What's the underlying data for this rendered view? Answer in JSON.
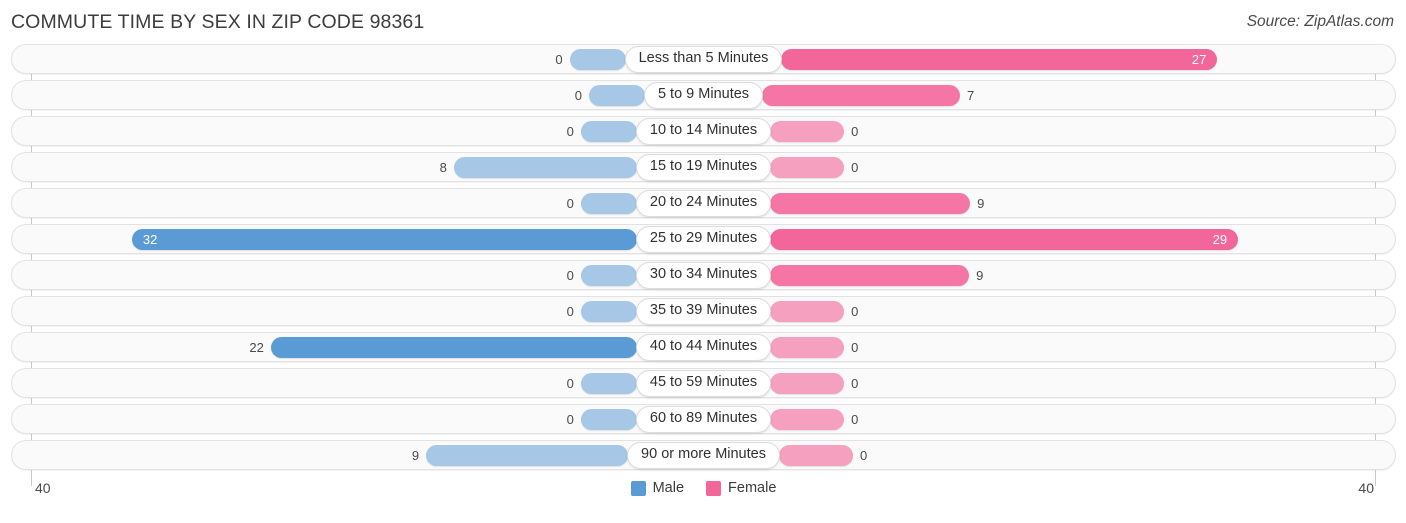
{
  "header": {
    "title": "COMMUTE TIME BY SEX IN ZIP CODE 98361",
    "source": "Source: ZipAtlas.com"
  },
  "axis": {
    "left_tick": "40",
    "right_tick": "40"
  },
  "legend": {
    "items": [
      {
        "label": "Male",
        "color": "#5b9bd5"
      },
      {
        "label": "Female",
        "color": "#f2669a"
      }
    ]
  },
  "colors": {
    "male_strong": "#5b9bd5",
    "male_light": "#a7c7e7",
    "female_strong": "#f2669a",
    "female_mid": "#f576a4",
    "female_light": "#f5a0bf",
    "row_background": "#fafafa",
    "row_border": "#e2e2e2"
  },
  "chart_data": {
    "type": "bar",
    "title": "COMMUTE TIME BY SEX IN ZIP CODE 98361",
    "xlabel": "",
    "ylabel": "",
    "orientation": "horizontal-diverging",
    "xlim": [
      40,
      40
    ],
    "grid": false,
    "legend_position": "bottom-center",
    "categories": [
      "Less than 5 Minutes",
      "5 to 9 Minutes",
      "10 to 14 Minutes",
      "15 to 19 Minutes",
      "20 to 24 Minutes",
      "25 to 29 Minutes",
      "30 to 34 Minutes",
      "35 to 39 Minutes",
      "40 to 44 Minutes",
      "45 to 59 Minutes",
      "60 to 89 Minutes",
      "90 or more Minutes"
    ],
    "series": [
      {
        "name": "Male",
        "values": [
          0,
          0,
          0,
          8,
          0,
          32,
          0,
          0,
          22,
          0,
          0,
          9
        ]
      },
      {
        "name": "Female",
        "values": [
          27,
          7,
          0,
          0,
          9,
          29,
          9,
          0,
          0,
          0,
          0,
          0
        ]
      }
    ]
  },
  "rows": [
    {
      "label": "Less than 5 Minutes",
      "male": "0",
      "female": "27",
      "male_w": 56,
      "female_w": 436,
      "male_shade": "light",
      "female_shade": "strong",
      "male_inside": false,
      "female_inside": true
    },
    {
      "label": "5 to 9 Minutes",
      "male": "0",
      "female": "7",
      "male_w": 56,
      "female_w": 198,
      "male_shade": "light",
      "female_shade": "mid",
      "male_inside": false,
      "female_inside": false
    },
    {
      "label": "10 to 14 Minutes",
      "male": "0",
      "female": "0",
      "male_w": 56,
      "female_w": 74,
      "male_shade": "light",
      "female_shade": "light",
      "male_inside": false,
      "female_inside": false
    },
    {
      "label": "15 to 19 Minutes",
      "male": "8",
      "female": "0",
      "male_w": 183,
      "female_w": 74,
      "male_shade": "light",
      "female_shade": "light",
      "male_inside": false,
      "female_inside": false
    },
    {
      "label": "20 to 24 Minutes",
      "male": "0",
      "female": "9",
      "male_w": 56,
      "female_w": 200,
      "male_shade": "light",
      "female_shade": "mid",
      "male_inside": false,
      "female_inside": false
    },
    {
      "label": "25 to 29 Minutes",
      "male": "32",
      "female": "29",
      "male_w": 505,
      "female_w": 468,
      "male_shade": "strong",
      "female_shade": "strong",
      "male_inside": true,
      "female_inside": true
    },
    {
      "label": "30 to 34 Minutes",
      "male": "0",
      "female": "9",
      "male_w": 56,
      "female_w": 199,
      "male_shade": "light",
      "female_shade": "mid",
      "male_inside": false,
      "female_inside": false
    },
    {
      "label": "35 to 39 Minutes",
      "male": "0",
      "female": "0",
      "male_w": 56,
      "female_w": 74,
      "male_shade": "light",
      "female_shade": "light",
      "male_inside": false,
      "female_inside": false
    },
    {
      "label": "40 to 44 Minutes",
      "male": "22",
      "female": "0",
      "male_w": 366,
      "female_w": 74,
      "male_shade": "strong",
      "female_shade": "light",
      "male_inside": false,
      "female_inside": false
    },
    {
      "label": "45 to 59 Minutes",
      "male": "0",
      "female": "0",
      "male_w": 56,
      "female_w": 74,
      "male_shade": "light",
      "female_shade": "light",
      "male_inside": false,
      "female_inside": false
    },
    {
      "label": "60 to 89 Minutes",
      "male": "0",
      "female": "0",
      "male_w": 56,
      "female_w": 74,
      "male_shade": "light",
      "female_shade": "light",
      "male_inside": false,
      "female_inside": false
    },
    {
      "label": "90 or more Minutes",
      "male": "9",
      "female": "0",
      "male_w": 202,
      "female_w": 74,
      "male_shade": "light",
      "female_shade": "light",
      "male_inside": false,
      "female_inside": false
    }
  ]
}
